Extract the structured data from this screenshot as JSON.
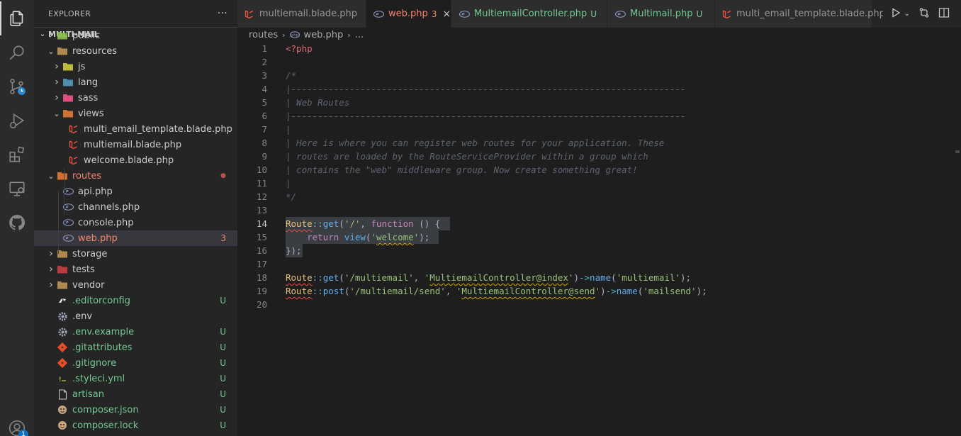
{
  "activity": {
    "items": [
      "explorer",
      "search",
      "source-control",
      "run-debug",
      "extensions",
      "remote-explorer",
      "github"
    ],
    "account_badge": "1"
  },
  "explorer": {
    "title": "EXPLORER",
    "more": "···",
    "project": "MULTI-MAIL",
    "rows": [
      {
        "label": "public",
        "type": "folder",
        "depth": 1,
        "open": false,
        "badge": ""
      },
      {
        "label": "resources",
        "type": "folder",
        "depth": 1,
        "open": true,
        "badge": ""
      },
      {
        "label": "js",
        "type": "folder",
        "depth": 2,
        "open": false,
        "badge": ""
      },
      {
        "label": "lang",
        "type": "folder",
        "depth": 2,
        "open": false,
        "badge": ""
      },
      {
        "label": "sass",
        "type": "folder",
        "depth": 2,
        "open": false,
        "badge": ""
      },
      {
        "label": "views",
        "type": "folder",
        "depth": 2,
        "open": true,
        "badge": ""
      },
      {
        "label": "multi_email_template.blade.php",
        "type": "blade",
        "depth": 3,
        "badge": ""
      },
      {
        "label": "multiemail.blade.php",
        "type": "blade",
        "depth": 3,
        "badge": ""
      },
      {
        "label": "welcome.blade.php",
        "type": "blade",
        "depth": 3,
        "badge": ""
      },
      {
        "label": "routes",
        "type": "folder",
        "depth": 1,
        "open": true,
        "badge": "●"
      },
      {
        "label": "api.php",
        "type": "php",
        "depth": 2,
        "badge": ""
      },
      {
        "label": "channels.php",
        "type": "php",
        "depth": 2,
        "badge": ""
      },
      {
        "label": "console.php",
        "type": "php",
        "depth": 2,
        "badge": ""
      },
      {
        "label": "web.php",
        "type": "php",
        "depth": 2,
        "badge": "3"
      },
      {
        "label": "storage",
        "type": "folder",
        "depth": 1,
        "open": false,
        "badge": ""
      },
      {
        "label": "tests",
        "type": "folder",
        "depth": 1,
        "open": false,
        "badge": ""
      },
      {
        "label": "vendor",
        "type": "folder",
        "depth": 1,
        "open": false,
        "badge": ""
      },
      {
        "label": ".editorconfig",
        "type": "file",
        "depth": 1,
        "badge": "U"
      },
      {
        "label": ".env",
        "type": "gear",
        "depth": 1,
        "badge": ""
      },
      {
        "label": ".env.example",
        "type": "gear",
        "depth": 1,
        "badge": "U"
      },
      {
        "label": ".gitattributes",
        "type": "git",
        "depth": 1,
        "badge": "U"
      },
      {
        "label": ".gitignore",
        "type": "git",
        "depth": 1,
        "badge": "U"
      },
      {
        "label": ".styleci.yml",
        "type": "yml",
        "depth": 1,
        "badge": "U"
      },
      {
        "label": "artisan",
        "type": "file",
        "depth": 1,
        "badge": "U"
      },
      {
        "label": "composer.json",
        "type": "composer",
        "depth": 1,
        "badge": "U"
      },
      {
        "label": "composer.lock",
        "type": "composer",
        "depth": 1,
        "badge": "U"
      }
    ]
  },
  "tabs": [
    {
      "label": "multiemail.blade.php",
      "status": "",
      "active": false,
      "type": "blade"
    },
    {
      "label": "web.php",
      "status": "3",
      "active": true,
      "type": "php"
    },
    {
      "label": "MultiemailController.php",
      "status": "U",
      "active": false,
      "type": "php"
    },
    {
      "label": "Multimail.php",
      "status": "U",
      "active": false,
      "type": "php"
    },
    {
      "label": "multi_email_template.blade.php",
      "status": "",
      "active": false,
      "type": "blade"
    }
  ],
  "breadcrumb": {
    "folder": "routes",
    "file": "web.php",
    "more": "..."
  },
  "editor": {
    "current_line": 14,
    "lines": [
      "<?php",
      "",
      "/*",
      "|--------------------------------------------------------------------------",
      "| Web Routes",
      "|--------------------------------------------------------------------------",
      "|",
      "| Here is where you can register web routes for your application. These",
      "| routes are loaded by the RouteServiceProvider within a group which",
      "| contains the \"web\" middleware group. Now create something great!",
      "|",
      "*/",
      "",
      "Route::get('/', function () {",
      "    return view('welcome');",
      "});",
      "",
      "Route::get('/multiemail', 'MultiemailController@index')->name('multiemail');",
      "Route::post('/multiemail/send', 'MultiemailController@send')->name('mailsend');",
      ""
    ]
  },
  "colors": {
    "accent_red": "#f48771",
    "untracked_green": "#73c991",
    "editor_bg": "#1e1e1e",
    "sidebar_bg": "#252526"
  }
}
